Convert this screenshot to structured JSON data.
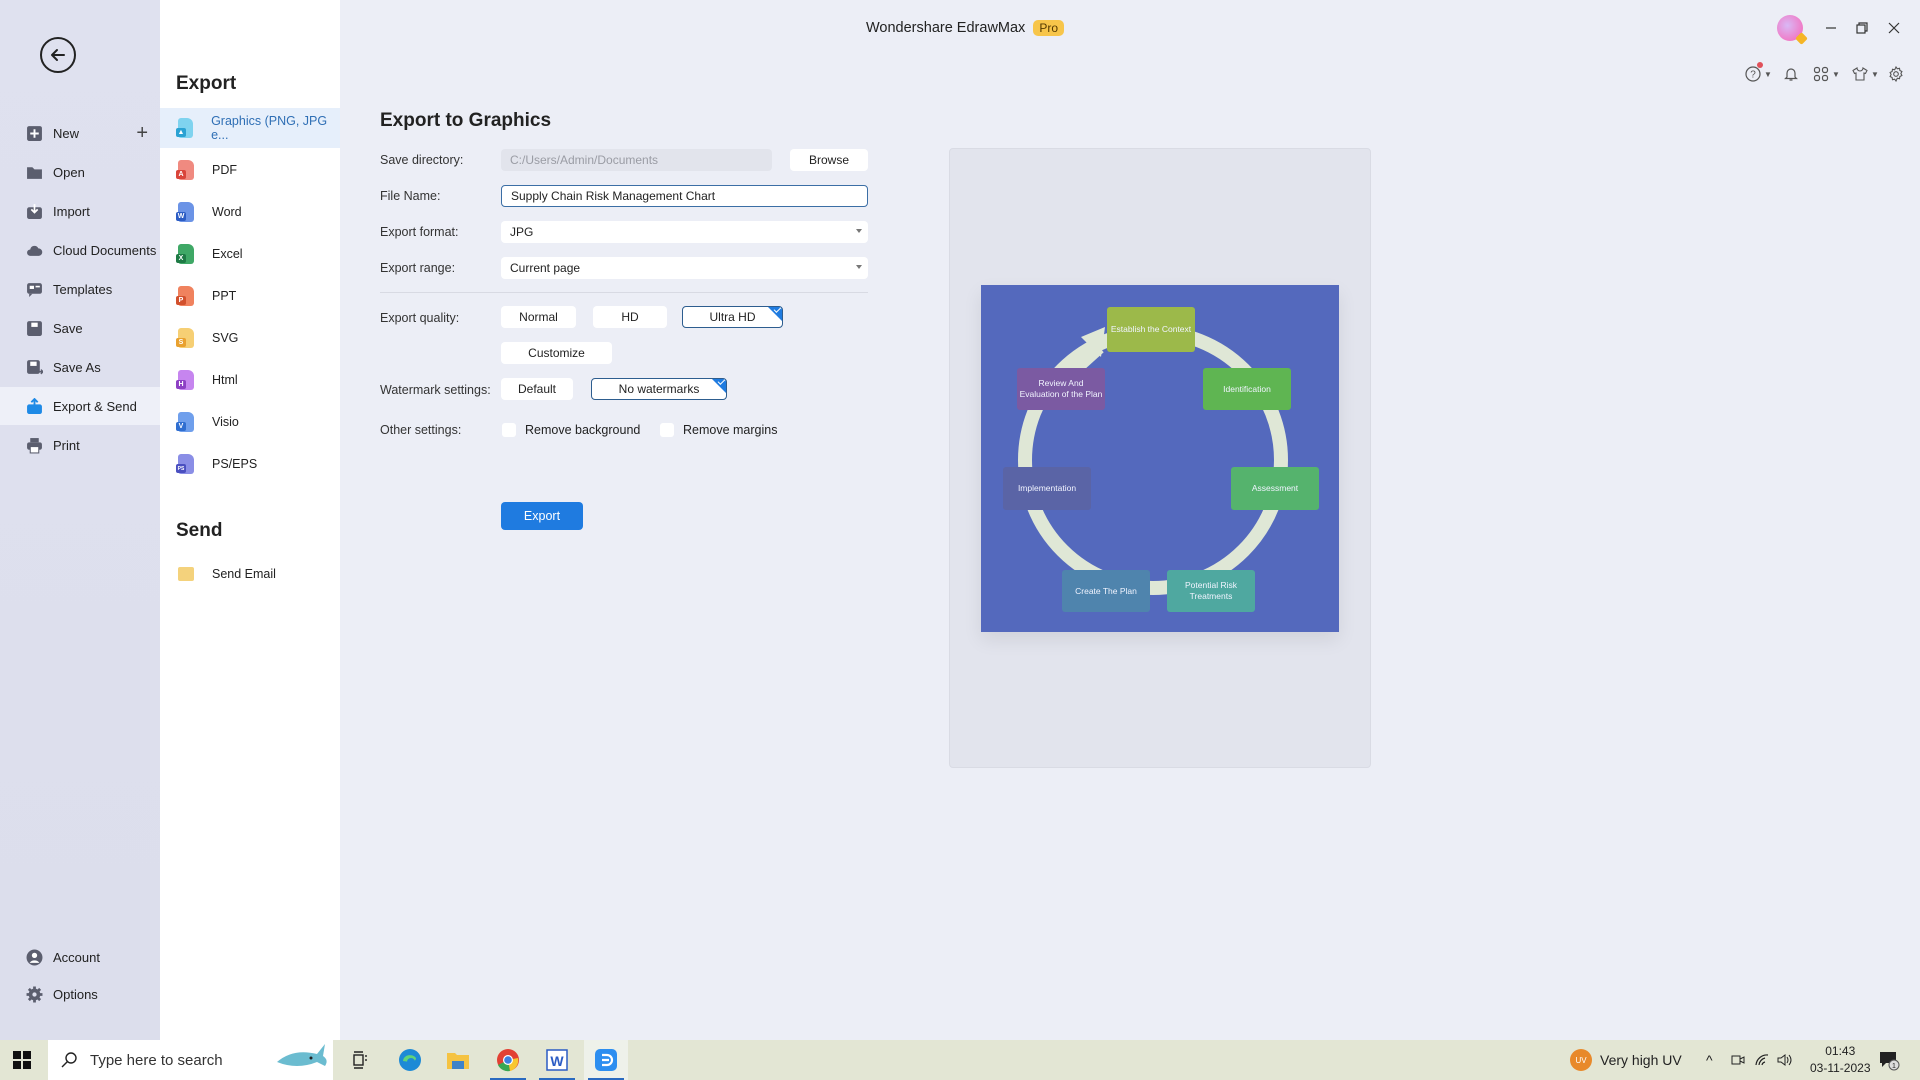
{
  "app": {
    "title": "Wondershare EdrawMax",
    "badge": "Pro"
  },
  "leftnav": {
    "items": [
      {
        "label": "New",
        "icon": "plus-square-icon"
      },
      {
        "label": "Open",
        "icon": "folder-icon"
      },
      {
        "label": "Import",
        "icon": "import-icon"
      },
      {
        "label": "Cloud Documents",
        "icon": "cloud-icon"
      },
      {
        "label": "Templates",
        "icon": "templates-icon"
      },
      {
        "label": "Save",
        "icon": "save-icon"
      },
      {
        "label": "Save As",
        "icon": "save-as-icon"
      },
      {
        "label": "Export & Send",
        "icon": "export-icon",
        "active": true
      },
      {
        "label": "Print",
        "icon": "print-icon"
      }
    ],
    "bottom": [
      {
        "label": "Account",
        "icon": "account-icon"
      },
      {
        "label": "Options",
        "icon": "gear-icon"
      }
    ]
  },
  "exportlist": {
    "export_title": "Export",
    "send_title": "Send",
    "items": [
      {
        "label": "Graphics (PNG, JPG e...",
        "badge": "",
        "color": "#3fb5e0",
        "active": true
      },
      {
        "label": "PDF",
        "badge": "A",
        "color": "#d9443a"
      },
      {
        "label": "Word",
        "badge": "W",
        "color": "#2b5cc4"
      },
      {
        "label": "Excel",
        "badge": "X",
        "color": "#1e7a45"
      },
      {
        "label": "PPT",
        "badge": "P",
        "color": "#d2502d"
      },
      {
        "label": "SVG",
        "badge": "S",
        "color": "#e9b03f"
      },
      {
        "label": "Html",
        "badge": "H",
        "color": "#8d3fc4"
      },
      {
        "label": "Visio",
        "badge": "V",
        "color": "#2f6ed0"
      },
      {
        "label": "PS/EPS",
        "badge": "PS",
        "color": "#4a4fc0"
      }
    ],
    "send_items": [
      {
        "label": "Send Email",
        "color": "#f1c65c"
      }
    ]
  },
  "form": {
    "title": "Export to Graphics",
    "save_directory_label": "Save directory:",
    "save_directory_value": "C:/Users/Admin/Documents",
    "browse_label": "Browse",
    "file_name_label": "File Name:",
    "file_name_value": "Supply Chain Risk Management Chart",
    "export_format_label": "Export format:",
    "export_format_value": "JPG",
    "export_range_label": "Export range:",
    "export_range_value": "Current page",
    "quality_label": "Export quality:",
    "quality_options": [
      "Normal",
      "HD",
      "Ultra HD"
    ],
    "quality_selected": "Ultra HD",
    "customize_label": "Customize",
    "watermark_label": "Watermark settings:",
    "watermark_options": [
      "Default",
      "No watermarks"
    ],
    "watermark_selected": "No watermarks",
    "other_label": "Other settings:",
    "remove_background_label": "Remove background",
    "remove_background_checked": false,
    "remove_margins_label": "Remove margins",
    "remove_margins_checked": false,
    "export_button": "Export"
  },
  "preview": {
    "background": "#5469bd",
    "steps": [
      {
        "label": "Establish the Context",
        "color": "#9cb94a"
      },
      {
        "label": "Identification",
        "color": "#5fb552"
      },
      {
        "label": "Assessment",
        "color": "#55b36d"
      },
      {
        "label": "Potential Risk Treatments",
        "color": "#4fa8a0"
      },
      {
        "label": "Create The Plan",
        "color": "#4f84ad"
      },
      {
        "label": "Implementation",
        "color": "#5a64a6"
      },
      {
        "label": "Review And Evaluation of the Plan",
        "color": "#7b5aa2"
      }
    ]
  },
  "taskbar": {
    "search_placeholder": "Type here to search",
    "weather": "Very high UV",
    "weather_badge": "UV",
    "time": "01:43",
    "date": "03-11-2023",
    "notification_count": "1"
  }
}
